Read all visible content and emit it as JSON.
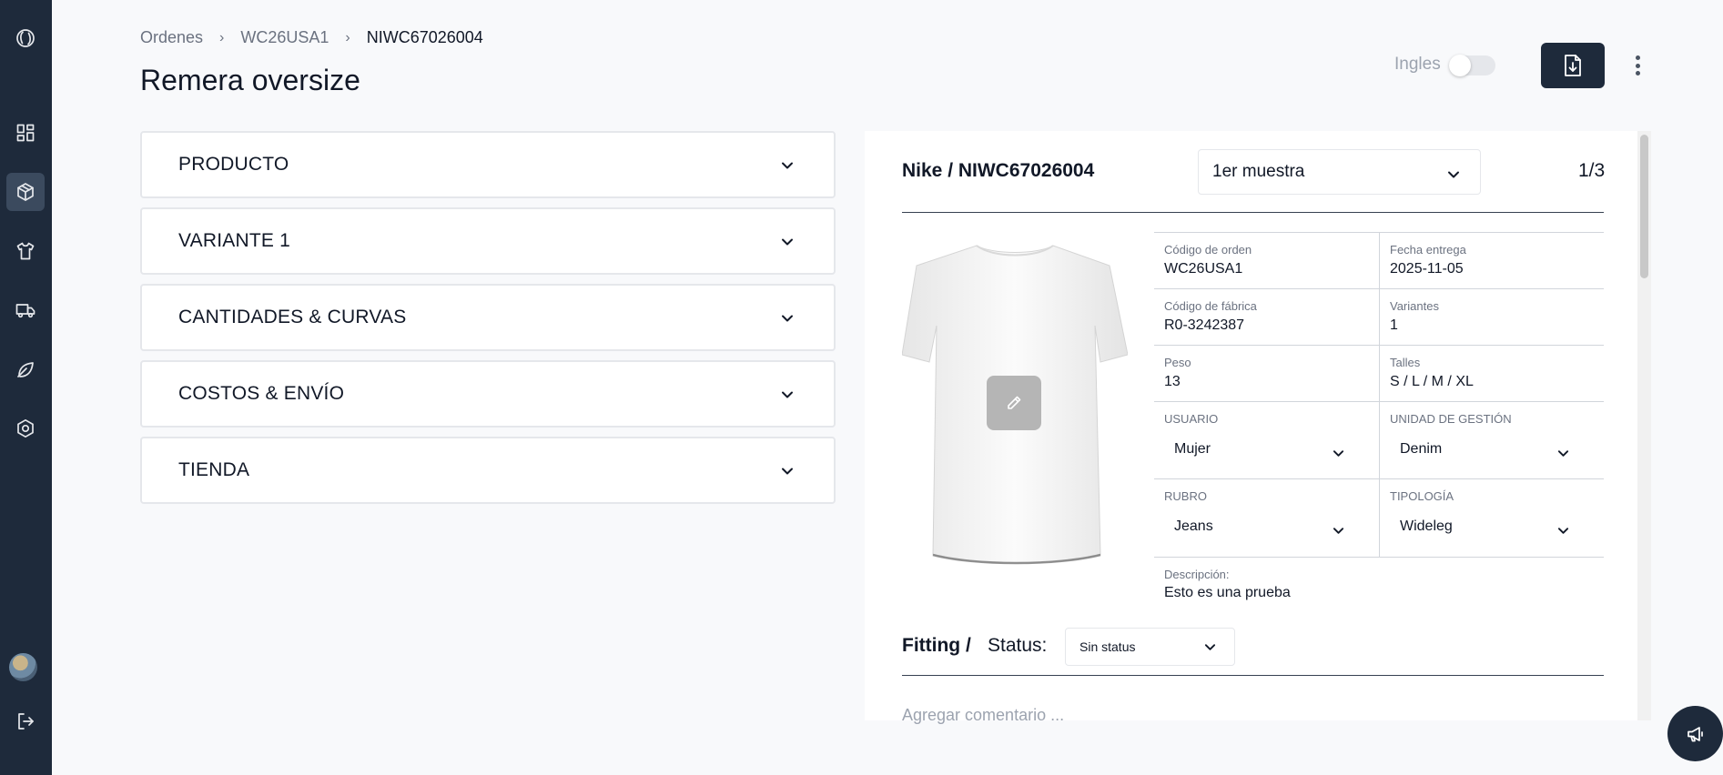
{
  "sidebar": {
    "items": [
      {
        "icon": "logo-icon"
      },
      {
        "icon": "dashboard-icon"
      },
      {
        "icon": "orders-box-icon",
        "active": true
      },
      {
        "icon": "tshirt-icon"
      },
      {
        "icon": "truck-icon"
      },
      {
        "icon": "leaf-icon"
      },
      {
        "icon": "settings-icon"
      }
    ],
    "avatar": "avatar",
    "logout_icon": "logout-icon"
  },
  "breadcrumb": {
    "items": [
      "Ordenes",
      "WC26USA1",
      "NIWC67026004"
    ]
  },
  "page_title": "Remera oversize",
  "header": {
    "language_label": "Ingles",
    "language_toggle_on": false,
    "download_icon": "file-download-icon",
    "more_icon": "kebab-menu-icon"
  },
  "sections": [
    {
      "label": "PRODUCTO"
    },
    {
      "label": "VARIANTE 1"
    },
    {
      "label": "CANTIDADES & CURVAS"
    },
    {
      "label": "COSTOS & ENVÍO"
    },
    {
      "label": "TIENDA"
    }
  ],
  "detail": {
    "title": "Nike / NIWC67026004",
    "sample_select": "1er muestra",
    "page_count": "1/3",
    "fields": {
      "order_code": {
        "label": "Código de orden",
        "value": "WC26USA1"
      },
      "delivery_date": {
        "label": "Fecha entrega",
        "value": "2025-11-05"
      },
      "factory_code": {
        "label": "Código de fábrica",
        "value": "R0-3242387"
      },
      "variants": {
        "label": "Variantes",
        "value": "1"
      },
      "weight": {
        "label": "Peso",
        "value": "13"
      },
      "sizes": {
        "label": "Talles",
        "value": "S / L / M / XL"
      },
      "user": {
        "label": "USUARIO",
        "value": "Mujer"
      },
      "management_unit": {
        "label": "UNIDAD DE GESTIÓN",
        "value": "Denim"
      },
      "category": {
        "label": "RUBRO",
        "value": "Jeans"
      },
      "typology": {
        "label": "TIPOLOGÍA",
        "value": "Wideleg"
      }
    },
    "description": {
      "label": "Descripción:",
      "value": "Esto es una prueba"
    },
    "fitting_label": "Fitting /",
    "status_label": "Status:",
    "status_value": "Sin status",
    "comment_placeholder": "Agregar comentario ..."
  },
  "colors": {
    "sidebar_bg": "#1e2a3b",
    "page_bg": "#f8f9fb",
    "accent_dark": "#1e2a3b"
  }
}
